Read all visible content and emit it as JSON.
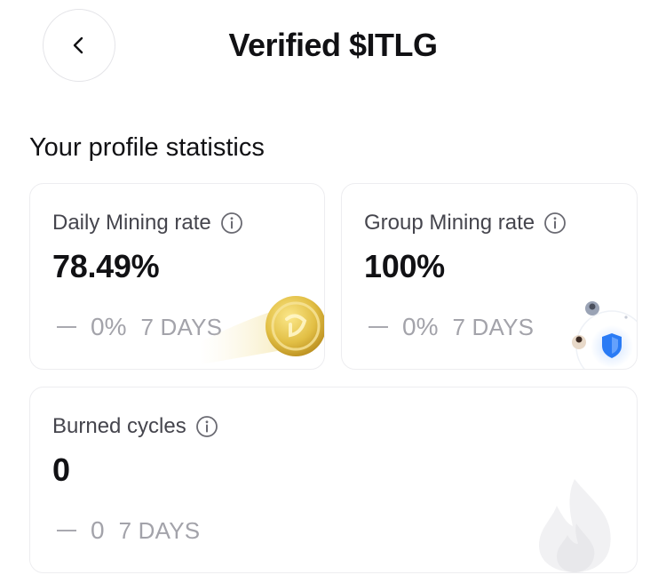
{
  "header": {
    "title": "Verified $ITLG",
    "back_icon": "chevron-left-icon"
  },
  "section": {
    "title": "Your profile statistics"
  },
  "cards": [
    {
      "label": "Daily Mining rate",
      "value": "78.49%",
      "change": "0%",
      "period": "7 DAYS",
      "icon": "info-icon",
      "decoration": "coin-icon"
    },
    {
      "label": "Group Mining rate",
      "value": "100%",
      "change": "0%",
      "period": "7 DAYS",
      "icon": "info-icon",
      "decoration": "shield-network-icon"
    },
    {
      "label": "Burned cycles",
      "value": "0",
      "change": "0",
      "period": "7 DAYS",
      "icon": "info-icon",
      "decoration": "flame-icon"
    }
  ],
  "colors": {
    "text_primary": "#111114",
    "text_secondary": "#45454d",
    "text_muted": "#a3a3aa",
    "card_border": "#ededf0",
    "coin_gold": "#d9b53a",
    "shield_blue": "#2a7bf5"
  }
}
